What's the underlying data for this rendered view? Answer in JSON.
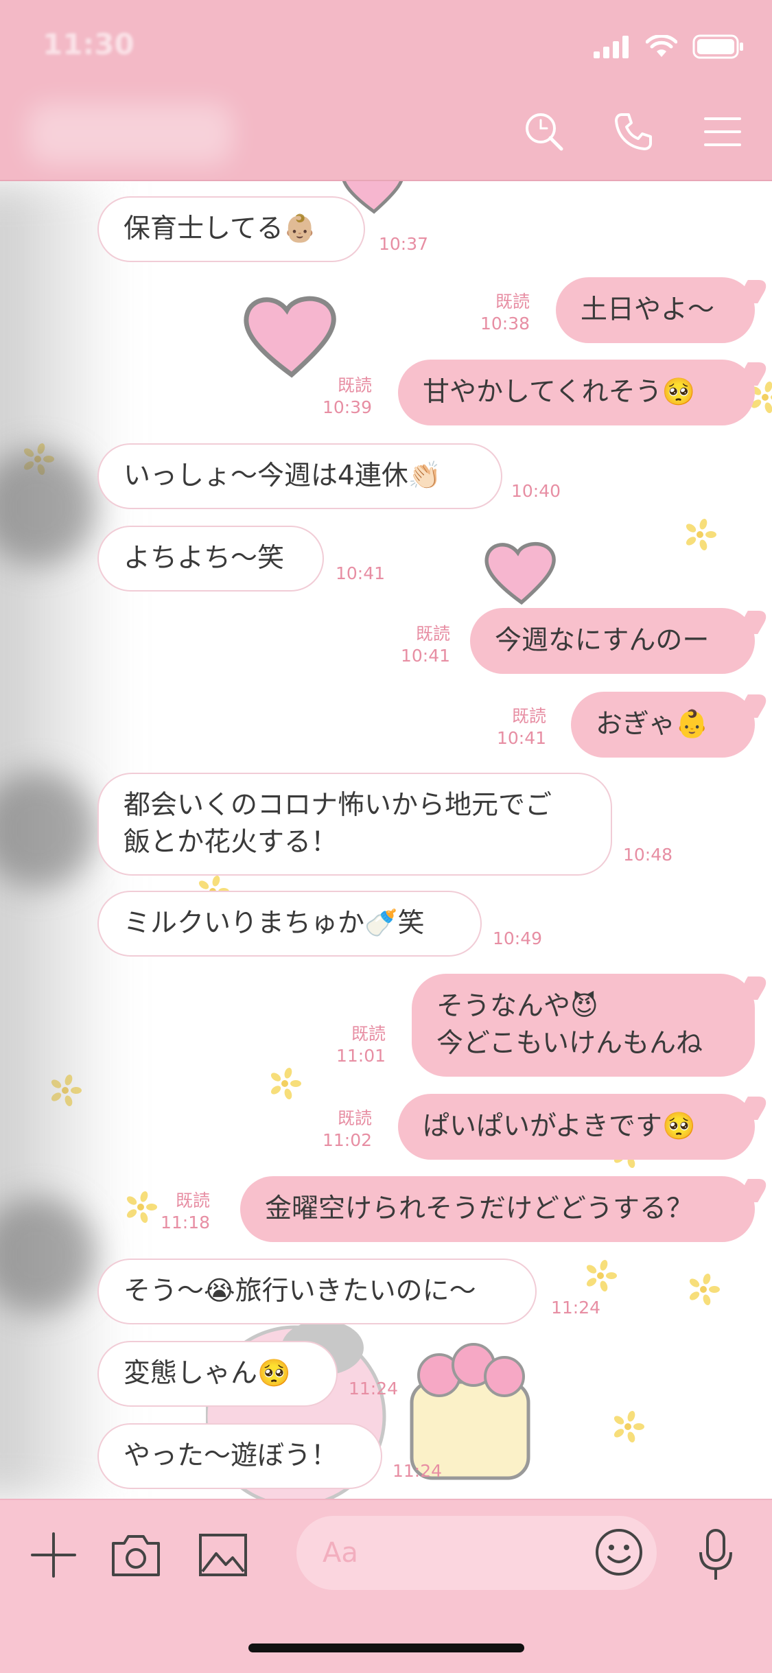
{
  "status_bar": {
    "time": "11:30"
  },
  "header": {
    "icons": [
      "search-icon",
      "phone-icon",
      "menu-icon"
    ]
  },
  "messages": [
    {
      "side": "in",
      "text": "保育士してる👶🏼",
      "time": "10:37",
      "read": ""
    },
    {
      "side": "out",
      "text": "土日やよ〜",
      "time": "10:38",
      "read": "既読"
    },
    {
      "side": "out",
      "text": "甘やかしてくれそう🥺",
      "time": "10:39",
      "read": "既読"
    },
    {
      "side": "in",
      "text": "いっしょ〜今週は4連休👏🏻",
      "time": "10:40",
      "read": ""
    },
    {
      "side": "in",
      "text": "よちよち〜笑",
      "time": "10:41",
      "read": ""
    },
    {
      "side": "out",
      "text": "今週なにすんのー",
      "time": "10:41",
      "read": "既読"
    },
    {
      "side": "out",
      "text": "おぎゃ👶",
      "time": "10:41",
      "read": "既読"
    },
    {
      "side": "in",
      "text": "都会いくのコロナ怖いから地元でご\n飯とか花火する！",
      "time": "10:48",
      "read": ""
    },
    {
      "side": "in",
      "text": "ミルクいりまちゅか🍼笑",
      "time": "10:49",
      "read": ""
    },
    {
      "side": "out",
      "text": "そうなんや😈\n今どこもいけんもんね",
      "time": "11:01",
      "read": "既読"
    },
    {
      "side": "out",
      "text": "ぱいぱいがよきです🥺",
      "time": "11:02",
      "read": "既読"
    },
    {
      "side": "out",
      "text": "金曜空けられそうだけどどうする？",
      "time": "11:18",
      "read": "既読"
    },
    {
      "side": "in",
      "text": "そう〜😭旅行いきたいのに〜",
      "time": "11:24",
      "read": ""
    },
    {
      "side": "in",
      "text": "変態しゃん🥺",
      "time": "11:24",
      "read": ""
    },
    {
      "side": "in",
      "text": "やった〜遊ぼう！",
      "time": "11:24",
      "read": ""
    }
  ],
  "input_bar": {
    "placeholder": "Aa",
    "icons": [
      "plus-icon",
      "camera-icon",
      "image-icon",
      "emoji-icon",
      "microphone-icon"
    ]
  },
  "colors": {
    "header_bg": "#f3b9c6",
    "outgoing_bubble": "#f8c0cc",
    "incoming_bubble": "#ffffff",
    "meta_text": "#e78ea3",
    "input_bar_bg": "#f8c5d1"
  }
}
